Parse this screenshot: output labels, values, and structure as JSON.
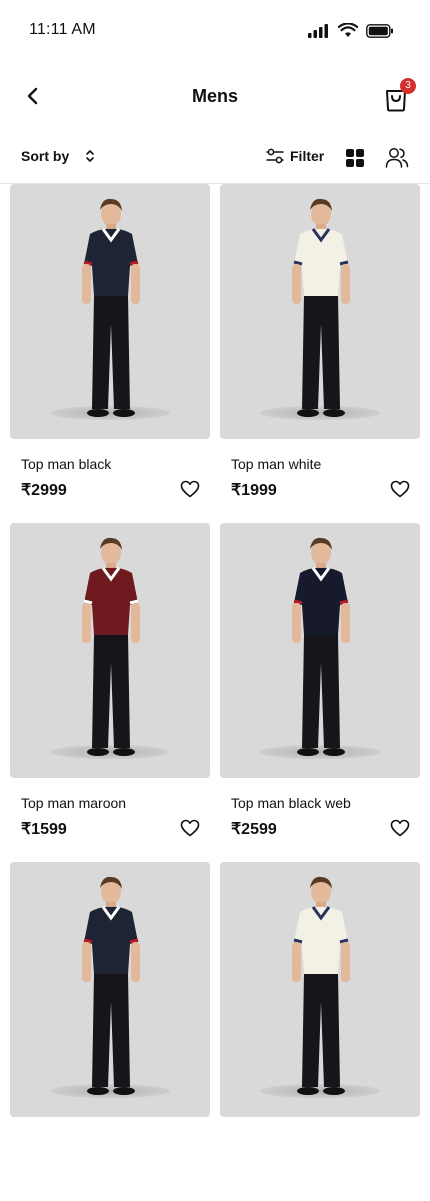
{
  "status": {
    "time": "11:11 AM"
  },
  "header": {
    "title": "Mens",
    "cart_count": "3"
  },
  "toolbar": {
    "sort_label": "Sort by",
    "filter_label": "Filter"
  },
  "products": [
    {
      "name": "Top man black",
      "price": "₹2999",
      "shirt": "#1e2433",
      "collar": "#ffffff",
      "trim": "#b61c2a"
    },
    {
      "name": "Top man white",
      "price": "₹1999",
      "shirt": "#f3f0e6",
      "collar": "#27335a",
      "trim": "#27335a"
    },
    {
      "name": "Top man maroon",
      "price": "₹1599",
      "shirt": "#6e1a1f",
      "collar": "#ffffff",
      "trim": "#ffffff"
    },
    {
      "name": "Top man black web",
      "price": "₹2599",
      "shirt": "#161a2c",
      "collar": "#ffffff",
      "trim": "#b61c2a"
    },
    {
      "name": "",
      "price": "",
      "shirt": "#1e2433",
      "collar": "#ffffff",
      "trim": "#b61c2a"
    },
    {
      "name": "",
      "price": "",
      "shirt": "#f3f0e6",
      "collar": "#27335a",
      "trim": "#27335a"
    }
  ]
}
